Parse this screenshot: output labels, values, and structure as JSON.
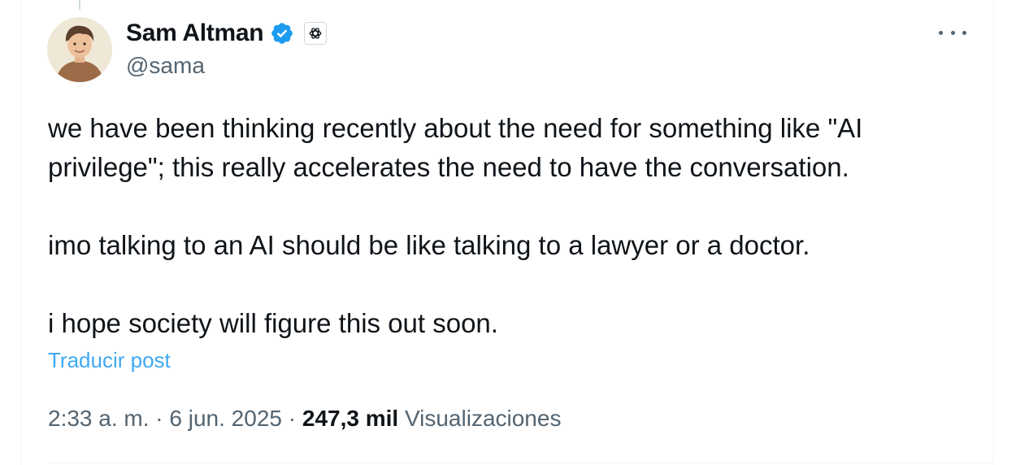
{
  "tweet": {
    "author": {
      "display_name": "Sam Altman",
      "handle": "@sama",
      "verified_icon": "verified-badge-icon",
      "affiliation_icon": "openai-logo-icon",
      "avatar": "cartoon-portrait-avatar"
    },
    "more_icon": "more-options-icon",
    "paragraphs": [
      "we have been thinking recently about the need for something like \"AI privilege\"; this really accelerates the need to have the conversation.",
      "imo talking to an AI should be like talking to a lawyer or a doctor.",
      "i hope society will figure this out soon."
    ],
    "translate_link": "Traducir post",
    "meta": {
      "time": "2:33 a. m.",
      "separator": "·",
      "date": "6 jun. 2025",
      "views_count": "247,3 mil",
      "views_label": "Visualizaciones"
    }
  },
  "colors": {
    "text_primary": "#0f1419",
    "text_secondary": "#536471",
    "link_blue": "#1d9bf0",
    "verified_blue": "#1d9bf0",
    "border": "#eff3f4"
  }
}
